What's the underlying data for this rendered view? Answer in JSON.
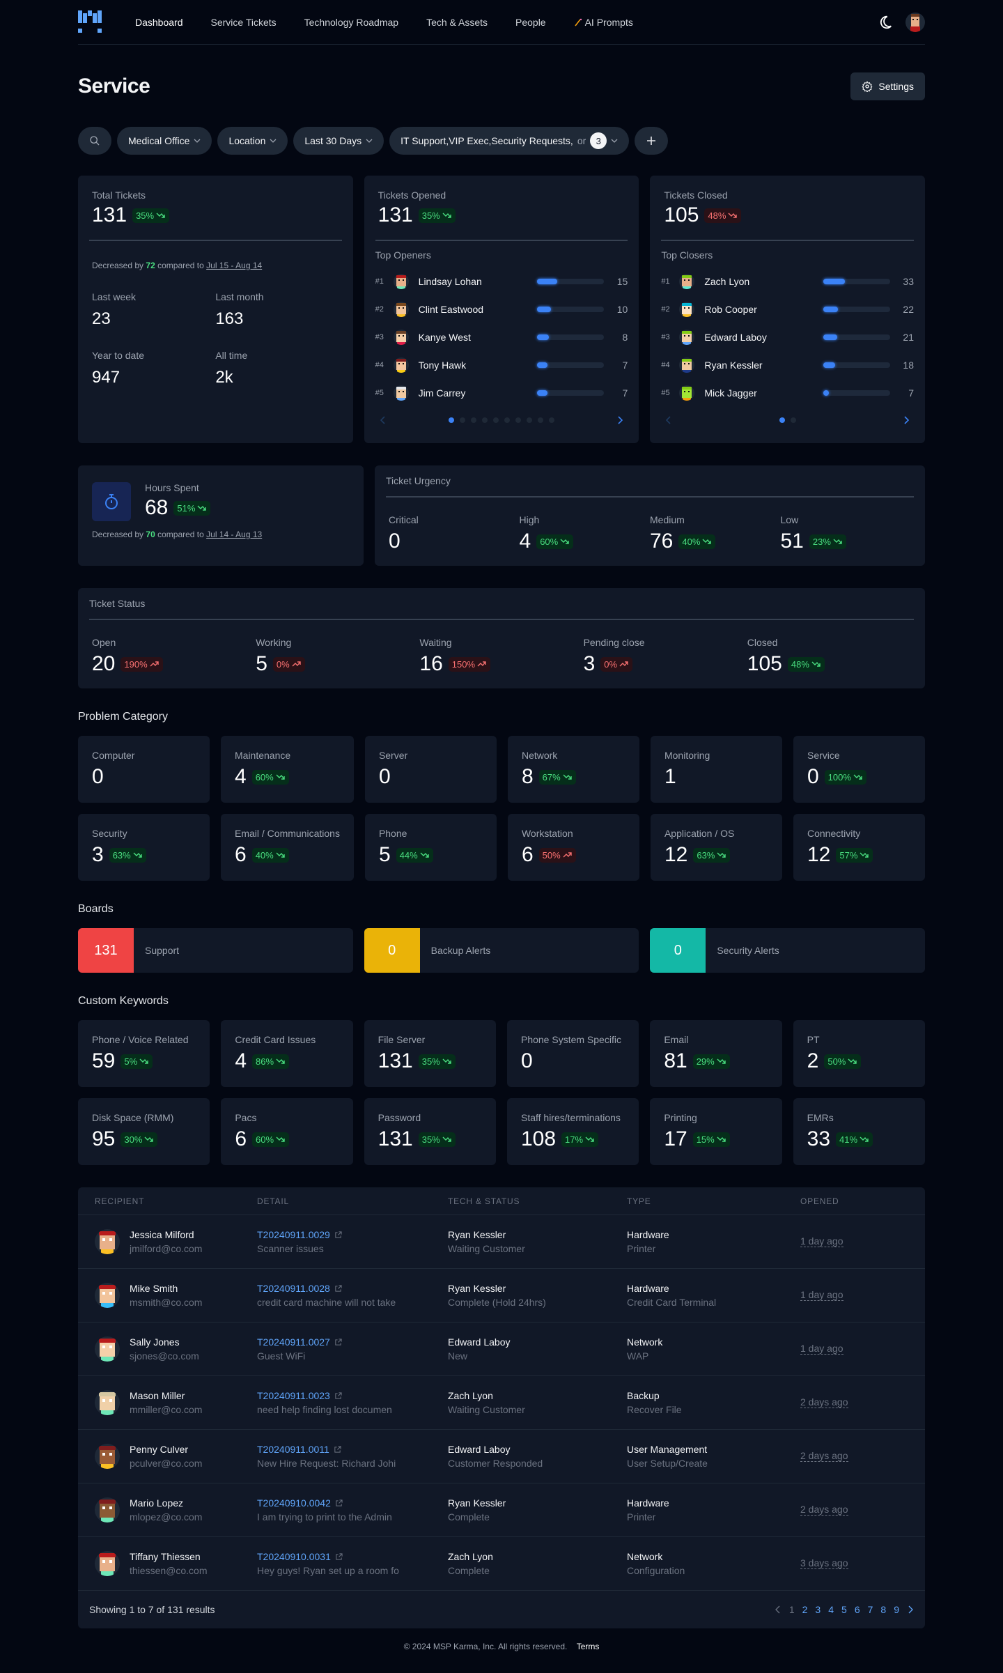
{
  "nav": {
    "links": [
      "Dashboard",
      "Service Tickets",
      "Technology Roadmap",
      "Tech & Assets",
      "People",
      "AI Prompts"
    ],
    "active": "Dashboard",
    "ai_icon": "magic-wand-icon"
  },
  "header": {
    "title": "Service",
    "settings_label": "Settings"
  },
  "filters": {
    "client": "Medical Office",
    "location": "Location",
    "range": "Last 30 Days",
    "boards": "IT Support,VIP Exec,Security Requests,",
    "boards_more": "or",
    "boards_more_count": "3"
  },
  "total": {
    "label": "Total Tickets",
    "value": "131",
    "change": "35%",
    "trend": "down",
    "desc_prefix": "Decreased by",
    "desc_amount": "72",
    "desc_mid": "compared to",
    "desc_range": "Jul 15 - Aug 14",
    "stats": [
      {
        "label": "Last week",
        "value": "23"
      },
      {
        "label": "Last month",
        "value": "163"
      },
      {
        "label": "Year to date",
        "value": "947"
      },
      {
        "label": "All time",
        "value": "2k"
      }
    ]
  },
  "opened": {
    "label": "Tickets Opened",
    "value": "131",
    "change": "35%",
    "trend": "down",
    "list_title": "Top Openers",
    "people": [
      {
        "rank": "#1",
        "name": "Lindsay Lohan",
        "count": "15",
        "fill": 0.3
      },
      {
        "rank": "#2",
        "name": "Clint Eastwood",
        "count": "10",
        "fill": 0.2
      },
      {
        "rank": "#3",
        "name": "Kanye West",
        "count": "8",
        "fill": 0.17
      },
      {
        "rank": "#4",
        "name": "Tony Hawk",
        "count": "7",
        "fill": 0.15
      },
      {
        "rank": "#5",
        "name": "Jim Carrey",
        "count": "7",
        "fill": 0.15
      }
    ],
    "pages": 10,
    "current_page": 1
  },
  "closed": {
    "label": "Tickets Closed",
    "value": "105",
    "change": "48%",
    "trend": "down-bad",
    "list_title": "Top Closers",
    "people": [
      {
        "rank": "#1",
        "name": "Zach Lyon",
        "count": "33",
        "fill": 0.32
      },
      {
        "rank": "#2",
        "name": "Rob Cooper",
        "count": "22",
        "fill": 0.22
      },
      {
        "rank": "#3",
        "name": "Edward Laboy",
        "count": "21",
        "fill": 0.21
      },
      {
        "rank": "#4",
        "name": "Ryan Kessler",
        "count": "18",
        "fill": 0.18
      },
      {
        "rank": "#5",
        "name": "Mick Jagger",
        "count": "7",
        "fill": 0.07
      }
    ],
    "pages": 2,
    "current_page": 1
  },
  "hours": {
    "label": "Hours Spent",
    "value": "68",
    "change": "51%",
    "trend": "down",
    "desc_prefix": "Decreased by",
    "desc_amount": "70",
    "desc_mid": "compared to",
    "desc_range": "Jul 14 - Aug 13"
  },
  "urgency": {
    "title": "Ticket Urgency",
    "items": [
      {
        "label": "Critical",
        "value": "0",
        "change": null
      },
      {
        "label": "High",
        "value": "4",
        "change": "60%",
        "trend": "down"
      },
      {
        "label": "Medium",
        "value": "76",
        "change": "40%",
        "trend": "down"
      },
      {
        "label": "Low",
        "value": "51",
        "change": "23%",
        "trend": "down"
      }
    ]
  },
  "status": {
    "title": "Ticket Status",
    "items": [
      {
        "label": "Open",
        "value": "20",
        "change": "190%",
        "trend": "up-bad"
      },
      {
        "label": "Working",
        "value": "5",
        "change": "0%",
        "trend": "up-bad"
      },
      {
        "label": "Waiting",
        "value": "16",
        "change": "150%",
        "trend": "up-bad"
      },
      {
        "label": "Pending close",
        "value": "3",
        "change": "0%",
        "trend": "up-bad"
      },
      {
        "label": "Closed",
        "value": "105",
        "change": "48%",
        "trend": "down"
      }
    ]
  },
  "problem_category": {
    "title": "Problem Category",
    "items": [
      {
        "label": "Computer",
        "value": "0",
        "change": null
      },
      {
        "label": "Maintenance",
        "value": "4",
        "change": "60%",
        "trend": "down"
      },
      {
        "label": "Server",
        "value": "0",
        "change": null
      },
      {
        "label": "Network",
        "value": "8",
        "change": "67%",
        "trend": "down"
      },
      {
        "label": "Monitoring",
        "value": "1",
        "change": null
      },
      {
        "label": "Service",
        "value": "0",
        "change": "100%",
        "trend": "down"
      },
      {
        "label": "Security",
        "value": "3",
        "change": "63%",
        "trend": "down"
      },
      {
        "label": "Email / Communications",
        "value": "6",
        "change": "40%",
        "trend": "down"
      },
      {
        "label": "Phone",
        "value": "5",
        "change": "44%",
        "trend": "down"
      },
      {
        "label": "Workstation",
        "value": "6",
        "change": "50%",
        "trend": "up-bad"
      },
      {
        "label": "Application / OS",
        "value": "12",
        "change": "63%",
        "trend": "down"
      },
      {
        "label": "Connectivity",
        "value": "12",
        "change": "57%",
        "trend": "down"
      }
    ]
  },
  "boards": {
    "title": "Boards",
    "items": [
      {
        "count": "131",
        "label": "Support",
        "color": "#ef4444"
      },
      {
        "count": "0",
        "label": "Backup Alerts",
        "color": "#eab308"
      },
      {
        "count": "0",
        "label": "Security Alerts",
        "color": "#14b8a6"
      }
    ]
  },
  "keywords": {
    "title": "Custom Keywords",
    "items": [
      {
        "label": "Phone / Voice Related",
        "value": "59",
        "change": "5%",
        "trend": "down"
      },
      {
        "label": "Credit Card Issues",
        "value": "4",
        "change": "86%",
        "trend": "down"
      },
      {
        "label": "File Server",
        "value": "131",
        "change": "35%",
        "trend": "down"
      },
      {
        "label": "Phone System Specific",
        "value": "0",
        "change": null
      },
      {
        "label": "Email",
        "value": "81",
        "change": "29%",
        "trend": "down"
      },
      {
        "label": "PT",
        "value": "2",
        "change": "50%",
        "trend": "down"
      },
      {
        "label": "Disk Space (RMM)",
        "value": "95",
        "change": "30%",
        "trend": "down"
      },
      {
        "label": "Pacs",
        "value": "6",
        "change": "60%",
        "trend": "down"
      },
      {
        "label": "Password",
        "value": "131",
        "change": "35%",
        "trend": "down"
      },
      {
        "label": "Staff hires/terminations",
        "value": "108",
        "change": "17%",
        "trend": "down"
      },
      {
        "label": "Printing",
        "value": "17",
        "change": "15%",
        "trend": "down"
      },
      {
        "label": "EMRs",
        "value": "33",
        "change": "41%",
        "trend": "down"
      }
    ]
  },
  "table": {
    "headers": [
      "RECIPIENT",
      "DETAIL",
      "TECH & STATUS",
      "TYPE",
      "OPENED"
    ],
    "rows": [
      {
        "name": "Jessica Milford",
        "email": "jmilford@co.com",
        "ticket": "T20240911.0029",
        "detail": "Scanner issues",
        "tech": "Ryan Kessler",
        "status": "Waiting Customer",
        "type": "Hardware",
        "subtype": "Printer",
        "opened": "1 day ago"
      },
      {
        "name": "Mike Smith",
        "email": "msmith@co.com",
        "ticket": "T20240911.0028",
        "detail": "credit card machine will not take",
        "tech": "Ryan Kessler",
        "status": "Complete (Hold 24hrs)",
        "type": "Hardware",
        "subtype": "Credit Card Terminal",
        "opened": "1 day ago"
      },
      {
        "name": "Sally Jones",
        "email": "sjones@co.com",
        "ticket": "T20240911.0027",
        "detail": "Guest WiFi",
        "tech": "Edward Laboy",
        "status": "New",
        "type": "Network",
        "subtype": "WAP",
        "opened": "1 day ago"
      },
      {
        "name": "Mason Miller",
        "email": "mmiller@co.com",
        "ticket": "T20240911.0023",
        "detail": "need help finding lost documen",
        "tech": "Zach Lyon",
        "status": "Waiting Customer",
        "type": "Backup",
        "subtype": "Recover File",
        "opened": "2 days ago"
      },
      {
        "name": "Penny Culver",
        "email": "pculver@co.com",
        "ticket": "T20240911.0011",
        "detail": "New Hire Request: Richard Johi",
        "tech": "Edward Laboy",
        "status": "Customer Responded",
        "type": "User Management",
        "subtype": "User Setup/Create",
        "opened": "2 days ago"
      },
      {
        "name": "Mario Lopez",
        "email": "mlopez@co.com",
        "ticket": "T20240910.0042",
        "detail": "I am trying to print to the Admin",
        "tech": "Ryan Kessler",
        "status": "Complete",
        "type": "Hardware",
        "subtype": "Printer",
        "opened": "2 days ago"
      },
      {
        "name": "Tiffany Thiessen",
        "email": "thiessen@co.com",
        "ticket": "T20240910.0031",
        "detail": "Hey guys! Ryan set up a room fo",
        "tech": "Zach Lyon",
        "status": "Complete",
        "type": "Network",
        "subtype": "Configuration",
        "opened": "3 days ago"
      }
    ],
    "summary": "Showing 1 to 7 of 131 results",
    "pages": [
      "1",
      "2",
      "3",
      "4",
      "5",
      "6",
      "7",
      "8",
      "9"
    ],
    "current_page": "1"
  },
  "footer": {
    "copyright": "© 2024 MSP Karma, Inc. All rights reserved.",
    "terms": "Terms"
  },
  "colors": {
    "accent": "#3b82f6",
    "good": "#4ade80",
    "bad": "#f87171",
    "card": "#111827",
    "bg": "#030712"
  }
}
